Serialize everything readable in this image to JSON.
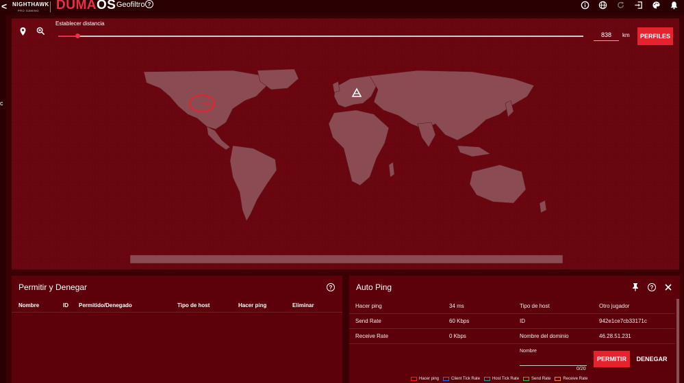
{
  "header": {
    "brand_chevron": "<",
    "brand_name": "NIGHTHAWK",
    "brand_sub": "PRO GAMING",
    "logo_part1": "DUMA",
    "logo_part2": "OS",
    "page_title": "Geofiltro",
    "icons": [
      "info-icon",
      "globe-icon",
      "refresh-icon",
      "sign-in-icon",
      "palette-icon",
      "bell-icon"
    ]
  },
  "sidebar": {
    "partial_text": "c"
  },
  "map": {
    "distance_label": "Establecer distancia",
    "distance_value": "838",
    "distance_unit": "km",
    "profiles_button": "PERFILES",
    "slider_level_fraction": 0.036,
    "tool_icons": [
      "map-pin-icon",
      "zoom-in-icon"
    ],
    "marker_icon": "triangle-marker-icon"
  },
  "allow_deny": {
    "title": "Permitir y Denegar",
    "columns": [
      "Nombre",
      "ID",
      "Permitido/Denegado",
      "Tipo de host",
      "Hacer ping",
      "Eliminar"
    ],
    "rows": []
  },
  "auto_ping": {
    "title": "Auto Ping",
    "rows": [
      {
        "label": "Hacer ping",
        "value": "34 ms",
        "label2": "Tipo de host",
        "value2": "Otro jugador"
      },
      {
        "label": "Send Rate",
        "value": "60 Kbps",
        "label2": "ID",
        "value2": "942e1ce7cb33171c"
      },
      {
        "label": "Receive Rate",
        "value": "0 Kbps",
        "label2": "Nombre del dominio",
        "value2": "46.28.51.231"
      }
    ],
    "name_label": "Nombre",
    "name_counter": "0/20",
    "allow_button": "PERMITIR",
    "deny_button": "DENEGAR",
    "legend": [
      {
        "name": "Hacer ping",
        "color": "#e4232f"
      },
      {
        "name": "Client Tick Rate",
        "color": "#2a6fdb"
      },
      {
        "name": "Host Tick Rate",
        "color": "#1aa3a3"
      },
      {
        "name": "Send Rate",
        "color": "#3cbf3c"
      },
      {
        "name": "Receive Rate",
        "color": "#f08a2a"
      }
    ]
  },
  "colors": {
    "accent": "#e4232f",
    "background": "#3a0004",
    "panel": "#5c0009",
    "map_panel": "#6a0610"
  }
}
